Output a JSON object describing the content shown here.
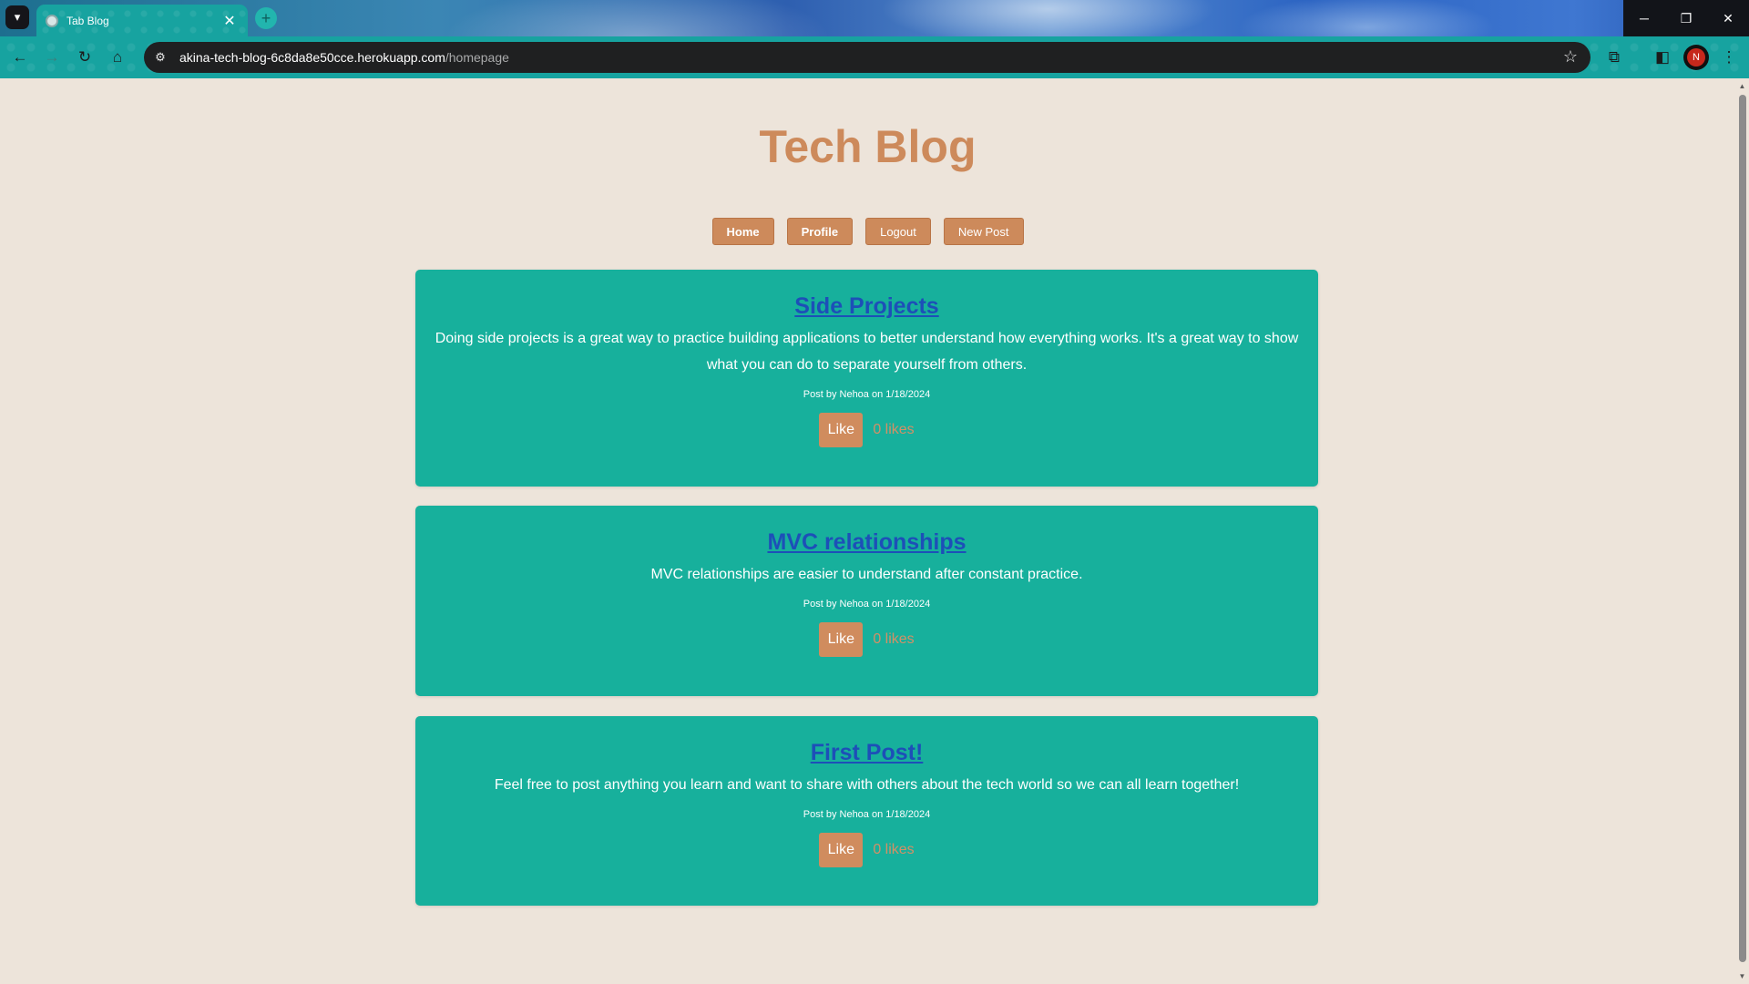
{
  "browser": {
    "tab_title": "Tab Blog",
    "url_host": "akina-tech-blog-6c8da8e50cce.herokuapp.com",
    "url_path": "/homepage",
    "profile_initial": "N",
    "icons": {
      "tab_list": "▾",
      "close": "✕",
      "new_tab": "+",
      "back": "←",
      "forward": "→",
      "reload": "↻",
      "home": "⌂",
      "site_info": "⚙",
      "star": "☆",
      "extensions": "⧉",
      "side_panel": "◧",
      "menu": "⋮",
      "minimize": "─",
      "restore": "❐",
      "window_close": "✕"
    }
  },
  "site": {
    "title": "Tech Blog"
  },
  "nav": {
    "home": "Home",
    "profile": "Profile",
    "logout": "Logout",
    "new_post": "New Post"
  },
  "posts": [
    {
      "title": "Side Projects",
      "body": "Doing side projects is a great way to practice building applications to better understand how everything works. It's a great way to show what you can do to separate yourself from others.",
      "meta": "Post by Nehoa on 1/18/2024",
      "like_label": "Like",
      "likes": "0 likes"
    },
    {
      "title": "MVC relationships",
      "body": "MVC relationships are easier to understand after constant practice.",
      "meta": "Post by Nehoa on 1/18/2024",
      "like_label": "Like",
      "likes": "0 likes"
    },
    {
      "title": "First Post!",
      "body": "Feel free to post anything you learn and want to share with others about the tech world so we can all learn together!",
      "meta": "Post by Nehoa on 1/18/2024",
      "like_label": "Like",
      "likes": "0 likes"
    }
  ],
  "colors": {
    "page_background": "#ede4da",
    "accent": "#cd8a5b",
    "card": "#17b09c",
    "link": "#1d4fb8"
  }
}
